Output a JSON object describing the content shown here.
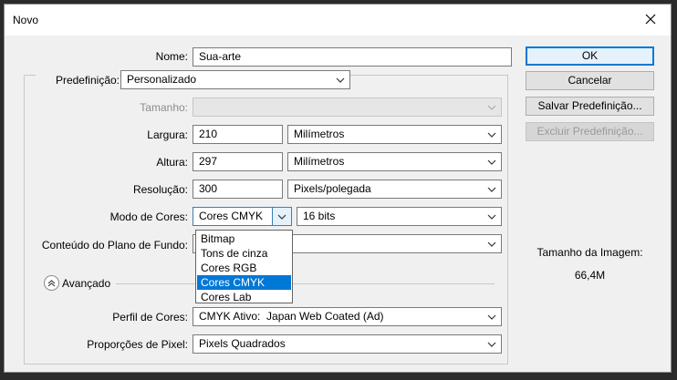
{
  "window": {
    "title": "Novo"
  },
  "form": {
    "name_label": "Nome:",
    "name_value": "Sua-arte",
    "preset_label": "Predefinição:",
    "preset_value": "Personalizado",
    "size_label": "Tamanho:",
    "width_label": "Largura:",
    "width_value": "210",
    "width_unit": "Milímetros",
    "height_label": "Altura:",
    "height_value": "297",
    "height_unit": "Milímetros",
    "resolution_label": "Resolução:",
    "resolution_value": "300",
    "resolution_unit": "Pixels/polegada",
    "color_mode_label": "Modo de Cores:",
    "color_mode_value": "Cores CMYK",
    "bit_depth_value": "16 bits",
    "background_label": "Conteúdo do Plano de Fundo:",
    "advanced_label": "Avançado",
    "color_profile_label": "Perfil de Cores:",
    "color_profile_value": "CMYK Ativo:  Japan Web Coated (Ad)",
    "pixel_aspect_label": "Proporções de Pixel:",
    "pixel_aspect_value": "Pixels Quadrados"
  },
  "color_mode_options": [
    "Bitmap",
    "Tons de cinza",
    "Cores RGB",
    "Cores CMYK",
    "Cores Lab"
  ],
  "color_mode_selected_index": 3,
  "buttons": {
    "ok": "OK",
    "cancel": "Cancelar",
    "save_preset": "Salvar Predefinição...",
    "delete_preset": "Excluir Predefinição..."
  },
  "image_size": {
    "label": "Tamanho da Imagem:",
    "value": "66,4M"
  },
  "icons": {
    "close": "close-icon",
    "chevron": "chevron-down-icon",
    "advanced": "chevron-up-icon"
  },
  "colors": {
    "accent": "#0078d7",
    "dialog_bg": "#f0f0f0",
    "backdrop": "#2b2b2b"
  }
}
